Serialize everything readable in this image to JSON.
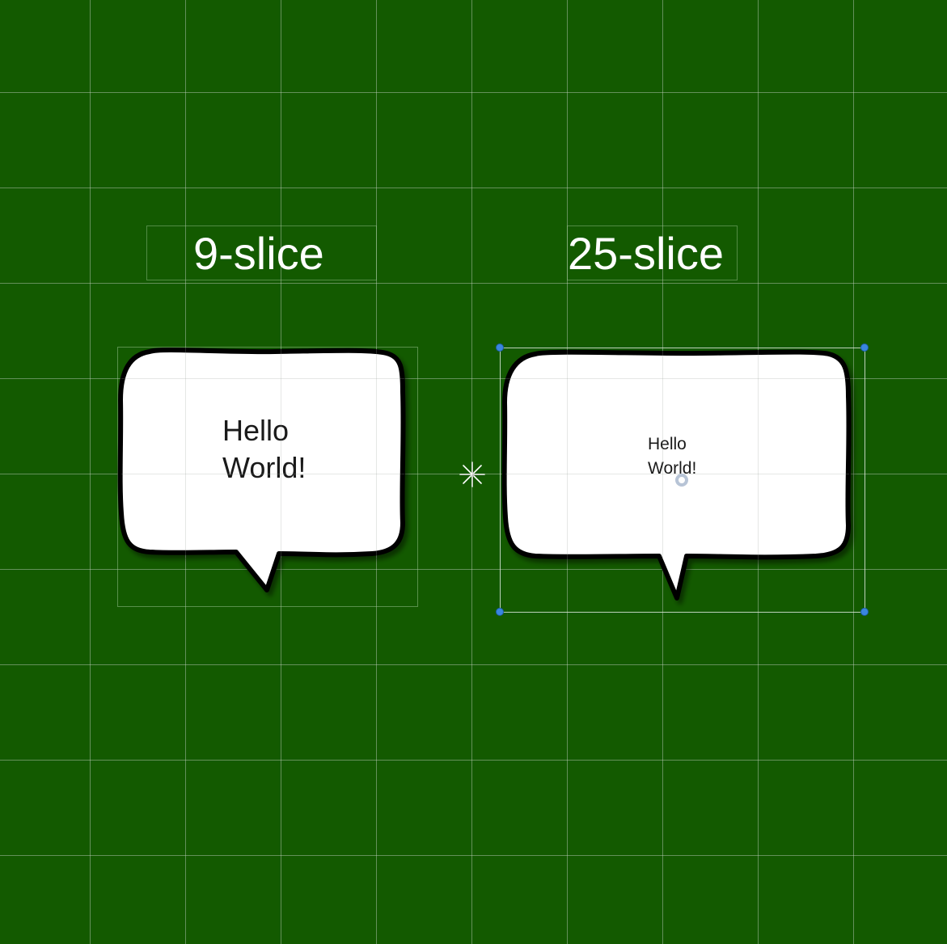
{
  "scene": {
    "background_color": "#135a00",
    "grid_color": "#c8d2c8"
  },
  "left_panel": {
    "title": "9-slice",
    "bubble_text_line1": "Hello",
    "bubble_text_line2": "World!"
  },
  "right_panel": {
    "title": "25-slice",
    "bubble_text_line1": "Hello",
    "bubble_text_line2": "World!",
    "selected": true,
    "handle_color": "#3a86e0"
  },
  "icons": {
    "pivot": "asterisk-pivot-icon",
    "center": "ring-center-icon"
  }
}
